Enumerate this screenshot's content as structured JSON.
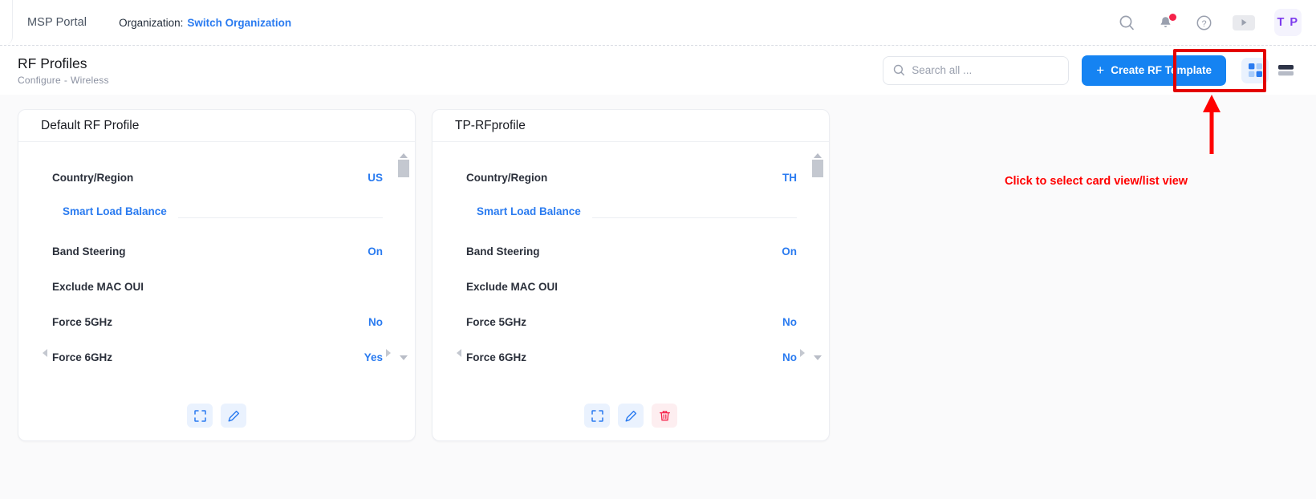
{
  "topbar": {
    "brand": "MSP Portal",
    "org_label": "Organization:",
    "org_link": "Switch Organization",
    "avatar_initials": "T P",
    "icons": {
      "search": "search-icon",
      "notifications": "bell-icon",
      "help": "question-circle-icon",
      "video": "play-icon"
    }
  },
  "page": {
    "title": "RF Profiles",
    "breadcrumb_parent": "Configure",
    "breadcrumb_sep": "-",
    "breadcrumb_child": "Wireless"
  },
  "search": {
    "placeholder": "Search all ...",
    "value": ""
  },
  "toolbar": {
    "create_label": "Create RF Template",
    "plus": "+",
    "view_card_label": "card-view",
    "view_list_label": "list-view",
    "active_view": "card"
  },
  "annotation": {
    "text": "Click to select card view/list view",
    "color": "#ff0000",
    "box_color": "#e30000"
  },
  "colors": {
    "accent": "#1583f2",
    "link": "#2a7bf0",
    "page_bg": "#fafafb",
    "card_bg": "#ffffff",
    "danger": "#f5224a",
    "avatar_text": "#7c3aed"
  },
  "cards": [
    {
      "title": "Default RF Profile",
      "rows": [
        {
          "key": "Country/Region",
          "value": "US",
          "sub": false
        },
        {
          "key": "Smart Load Balance",
          "value": "",
          "sub": true
        },
        {
          "key": "Band Steering",
          "value": "On",
          "sub": false
        },
        {
          "key": "Exclude MAC OUI",
          "value": "",
          "sub": false
        },
        {
          "key": "Force 5GHz",
          "value": "No",
          "sub": false
        },
        {
          "key": "Force 6GHz",
          "value": "Yes",
          "sub": false
        }
      ],
      "actions": [
        {
          "name": "expand-button",
          "icon": "expand-icon",
          "style": "blue"
        },
        {
          "name": "edit-button",
          "icon": "pencil-icon",
          "style": "blue"
        }
      ]
    },
    {
      "title": "TP-RFprofile",
      "rows": [
        {
          "key": "Country/Region",
          "value": "TH",
          "sub": false
        },
        {
          "key": "Smart Load Balance",
          "value": "",
          "sub": true
        },
        {
          "key": "Band Steering",
          "value": "On",
          "sub": false
        },
        {
          "key": "Exclude MAC OUI",
          "value": "",
          "sub": false
        },
        {
          "key": "Force 5GHz",
          "value": "No",
          "sub": false
        },
        {
          "key": "Force 6GHz",
          "value": "No",
          "sub": false
        }
      ],
      "actions": [
        {
          "name": "expand-button",
          "icon": "expand-icon",
          "style": "blue"
        },
        {
          "name": "edit-button",
          "icon": "pencil-icon",
          "style": "blue"
        },
        {
          "name": "delete-button",
          "icon": "trash-icon",
          "style": "red"
        }
      ]
    }
  ]
}
